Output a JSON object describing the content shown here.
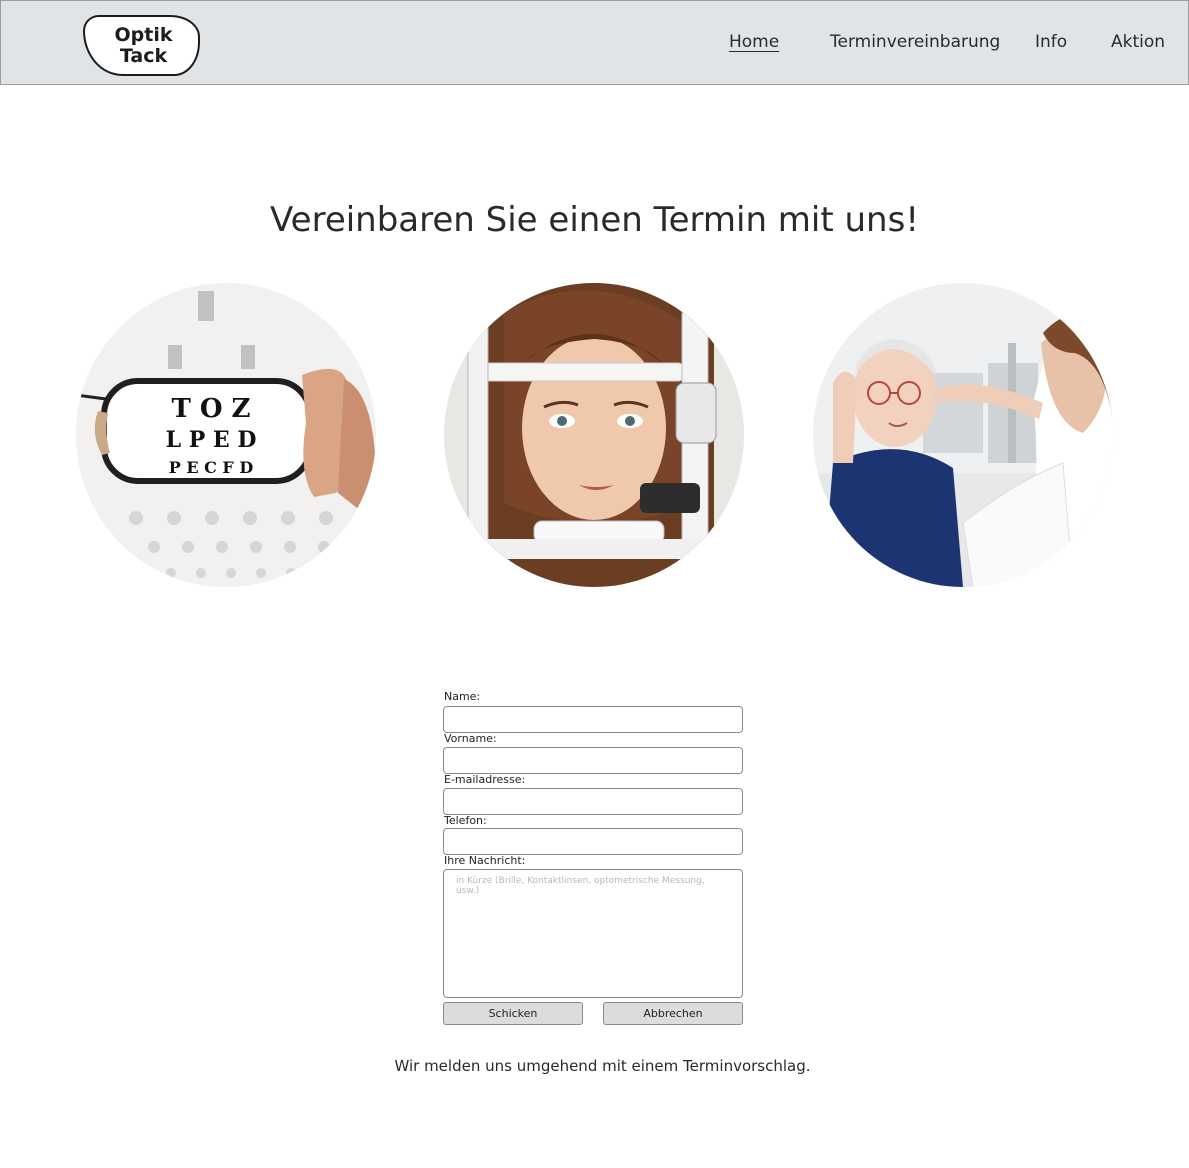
{
  "header": {
    "logo": {
      "line1": "Optik",
      "line2": "Tack"
    },
    "nav": [
      {
        "label": "Home",
        "active": true
      },
      {
        "label": "Terminvereinbarung"
      },
      {
        "label": "Info"
      },
      {
        "label": "Aktion"
      }
    ]
  },
  "hero": {
    "title": "Vereinbaren Sie einen Termin mit uns!"
  },
  "photos": [
    {
      "subject": "eye-chart-through-glasses",
      "chart_letters": [
        "T O Z",
        "L P E D",
        "P E C F D"
      ]
    },
    {
      "subject": "woman-at-slit-lamp-eye-exam"
    },
    {
      "subject": "optician-fitting-glasses-on-senior-woman"
    }
  ],
  "form": {
    "name_label": "Name:",
    "vorname_label": "Vorname:",
    "email_label": "E-mailadresse:",
    "telefon_label": "Telefon:",
    "message_label": "Ihre Nachricht:",
    "message_placeholder": "in Kürze (Brille, Kontaktlinsen, optometrische Messung, usw.)",
    "send_label": "Schicken",
    "cancel_label": "Abbrechen"
  },
  "footer_note": "Wir melden uns umgehend mit einem Terminvorschlag.",
  "colors": {
    "header_bg": "#e1e4e7",
    "button_bg": "#dcdcdc",
    "text": "#2a2a2a"
  }
}
